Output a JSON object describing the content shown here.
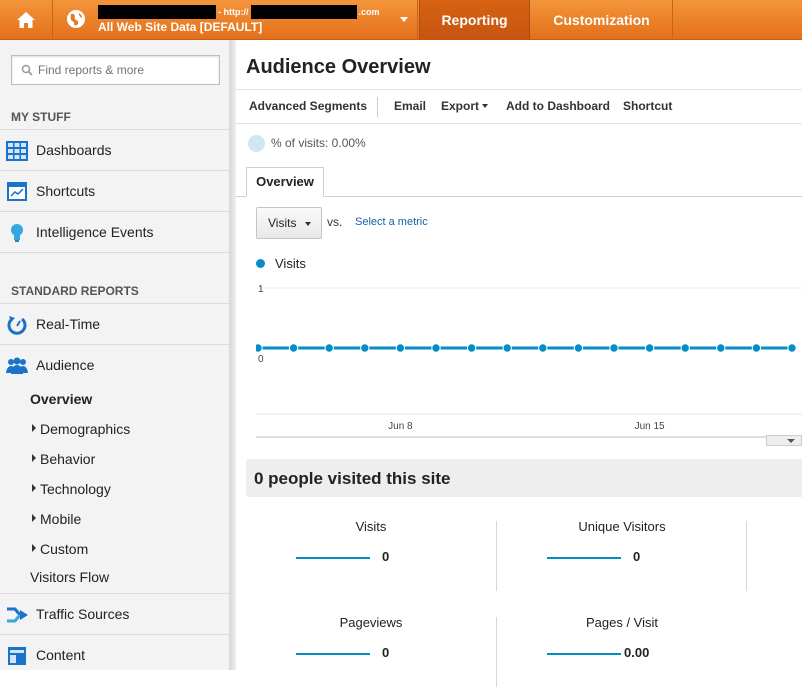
{
  "header": {
    "property_url_prefix": "- http://",
    "property_url_suffix": ".com",
    "view_name": "All Web Site Data [DEFAULT]",
    "tabs": [
      "Reporting",
      "Customization"
    ],
    "accent_color": "#ed7e22"
  },
  "sidebar": {
    "search_placeholder": "Find reports & more",
    "my_stuff_header": "MY STUFF",
    "my_stuff": [
      {
        "label": "Dashboards",
        "icon": "dashboards-icon"
      },
      {
        "label": "Shortcuts",
        "icon": "shortcuts-icon"
      },
      {
        "label": "Intelligence Events",
        "icon": "lightbulb-icon"
      }
    ],
    "standard_header": "STANDARD REPORTS",
    "realtime": "Real-Time",
    "audience": "Audience",
    "audience_sub": {
      "overview": "Overview",
      "demographics": "Demographics",
      "behavior": "Behavior",
      "technology": "Technology",
      "mobile": "Mobile",
      "custom": "Custom",
      "visitors_flow": "Visitors Flow"
    },
    "traffic_sources": "Traffic Sources",
    "content": "Content"
  },
  "main": {
    "title": "Audience Overview",
    "toolbar": {
      "advanced_segments": "Advanced Segments",
      "email": "Email",
      "export": "Export",
      "add_to_dashboard": "Add to Dashboard",
      "shortcut": "Shortcut"
    },
    "percent_visits": "% of visits: 0.00%",
    "tab_overview": "Overview",
    "metric_select": "Visits",
    "vs": "vs.",
    "select_metric": "Select a metric",
    "visited_banner": "0 people visited this site",
    "kpis": [
      {
        "name": "Visits",
        "value": "0"
      },
      {
        "name": "Unique Visitors",
        "value": "0"
      },
      {
        "name": "Pageviews",
        "value": "0"
      },
      {
        "name": "Pages / Visit",
        "value": "0.00"
      }
    ]
  },
  "chart_data": {
    "type": "line",
    "series": [
      {
        "name": "Visits",
        "values": [
          0,
          0,
          0,
          0,
          0,
          0,
          0,
          0,
          0,
          0,
          0,
          0,
          0,
          0,
          0,
          0
        ]
      }
    ],
    "y_ticks": [
      "1",
      "0"
    ],
    "ylim": [
      0,
      1
    ],
    "x_labels": [
      "Jun 8",
      "Jun 15"
    ],
    "x_label_indices": [
      4,
      11
    ],
    "grid": true,
    "color": "#058dc7"
  }
}
